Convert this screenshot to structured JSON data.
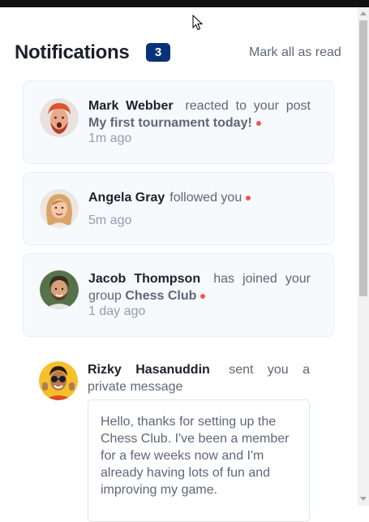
{
  "header": {
    "title": "Notifications",
    "unread_count": "3",
    "mark_all_label": "Mark all as read"
  },
  "notifications": [
    {
      "name": "Mark Webber",
      "action": "reacted to your post",
      "target": "My first tournament today!",
      "time": "1m ago",
      "unread": true
    },
    {
      "name": "Angela Gray",
      "action": "followed you",
      "target": "",
      "time": "5m ago",
      "unread": true
    },
    {
      "name": "Jacob Thompson",
      "action": "has joined your group",
      "target": "Chess Club",
      "time": "1 day ago",
      "unread": true
    },
    {
      "name": "Rizky Hasanuddin",
      "action": "sent you a private message",
      "message": "Hello, thanks for setting up the Chess Club. I've been a member for a few weeks now and I'm already having lots of fun and improving my game.",
      "unread": false
    }
  ],
  "colors": {
    "badge": "#0a327b",
    "unread_dot": "#f65552",
    "unread_bg": "#f7fafd"
  }
}
